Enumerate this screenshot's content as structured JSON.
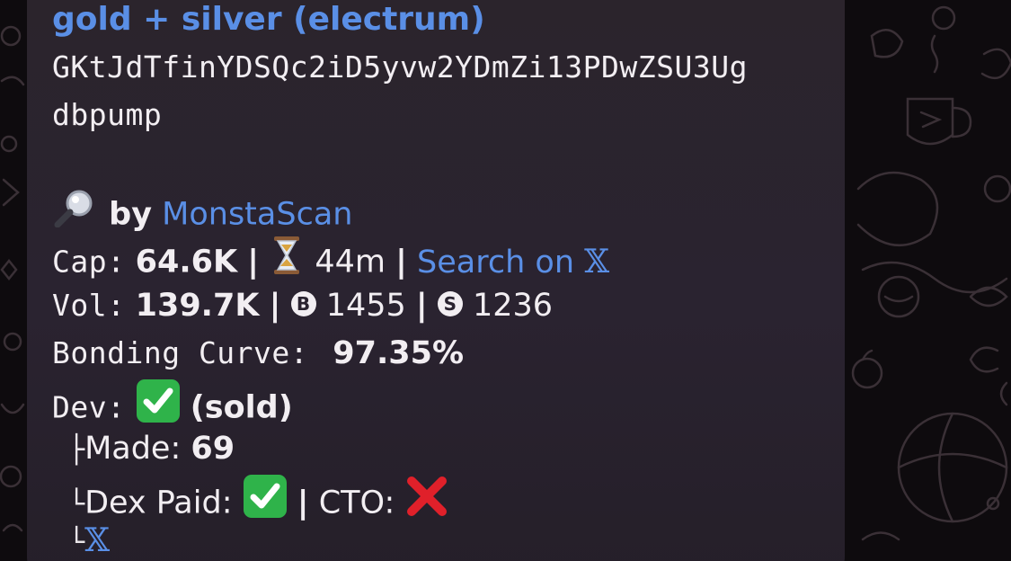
{
  "message": {
    "title": "gold + silver  (electrum)",
    "contract_address": "GKtJdTfinYDSQc2iD5yvw2YDmZi13PDwZSU3Ug",
    "platform": "dbpump",
    "scanner": {
      "prefix": "by",
      "name": "MonstaScan"
    },
    "cap": {
      "label": "Cap:",
      "value": "64.6K",
      "age": "44m",
      "search_label": "Search on",
      "separator": "|"
    },
    "vol": {
      "label": "Vol:",
      "value": "139.7K",
      "buys_letter": "B",
      "buys": "1455",
      "sells_letter": "S",
      "sells": "1236"
    },
    "bonding": {
      "label": "Bonding Curve:",
      "value": "97.35%"
    },
    "dev": {
      "label": "Dev:",
      "status": "(sold)",
      "made_prefix": "├",
      "made_label": "Made:",
      "made_value": "69",
      "dex_prefix": "└",
      "dex_label": "Dex Paid:",
      "cto_label": "CTO:",
      "x_prefix": "└"
    }
  },
  "icons": {
    "magnifier": "magnifier-icon",
    "hourglass": "hourglass-icon",
    "check": "check-box-icon",
    "cross": "red-cross-icon",
    "x_logo": "x-logo-icon"
  },
  "colors": {
    "link": "#5a8fe6",
    "bubble": "#2a2330",
    "check_green": "#2fb34a",
    "cross_red": "#e0202a"
  }
}
